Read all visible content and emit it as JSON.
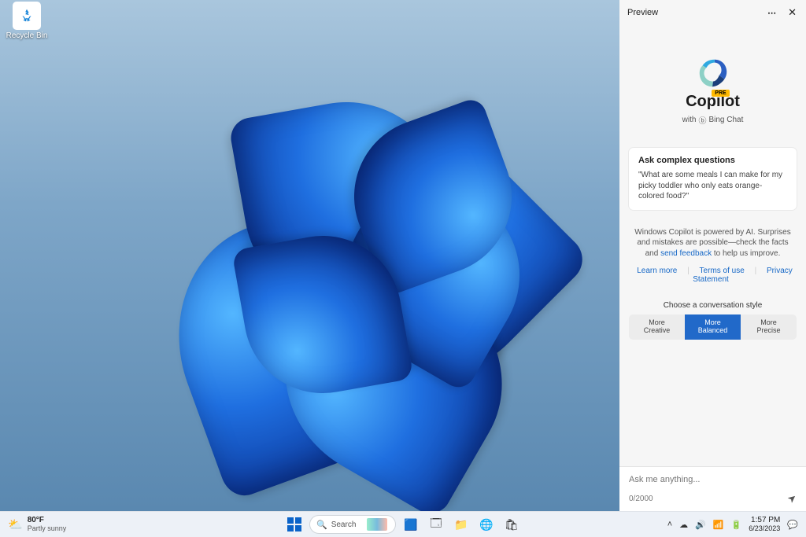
{
  "desktop": {
    "recycle_bin_label": "Recycle Bin"
  },
  "copilot": {
    "preview_label": "Preview",
    "pre_badge": "PRE",
    "title": "Copilot",
    "with_text": "with",
    "bing_chat": "Bing Chat",
    "card": {
      "title": "Ask complex questions",
      "body": "\"What are some meals I can make for my picky toddler who only eats orange-colored food?\""
    },
    "disclaimer_pre": "Windows Copilot is powered by AI. Surprises and mistakes are possible—check the facts and ",
    "disclaimer_link": "send feedback",
    "disclaimer_post": " to help us improve.",
    "links": {
      "learn_more": "Learn more",
      "terms": "Terms of use",
      "privacy": "Privacy Statement"
    },
    "style_label": "Choose a conversation style",
    "styles": {
      "creative_top": "More",
      "creative_bot": "Creative",
      "balanced_top": "More",
      "balanced_bot": "Balanced",
      "precise_top": "More",
      "precise_bot": "Precise"
    },
    "input_placeholder": "Ask me anything...",
    "char_count": "0/2000"
  },
  "taskbar": {
    "weather": {
      "temp": "80°F",
      "cond": "Partly sunny"
    },
    "search_text": "Search",
    "clock": {
      "time": "1:57 PM",
      "date": "6/23/2023"
    }
  }
}
